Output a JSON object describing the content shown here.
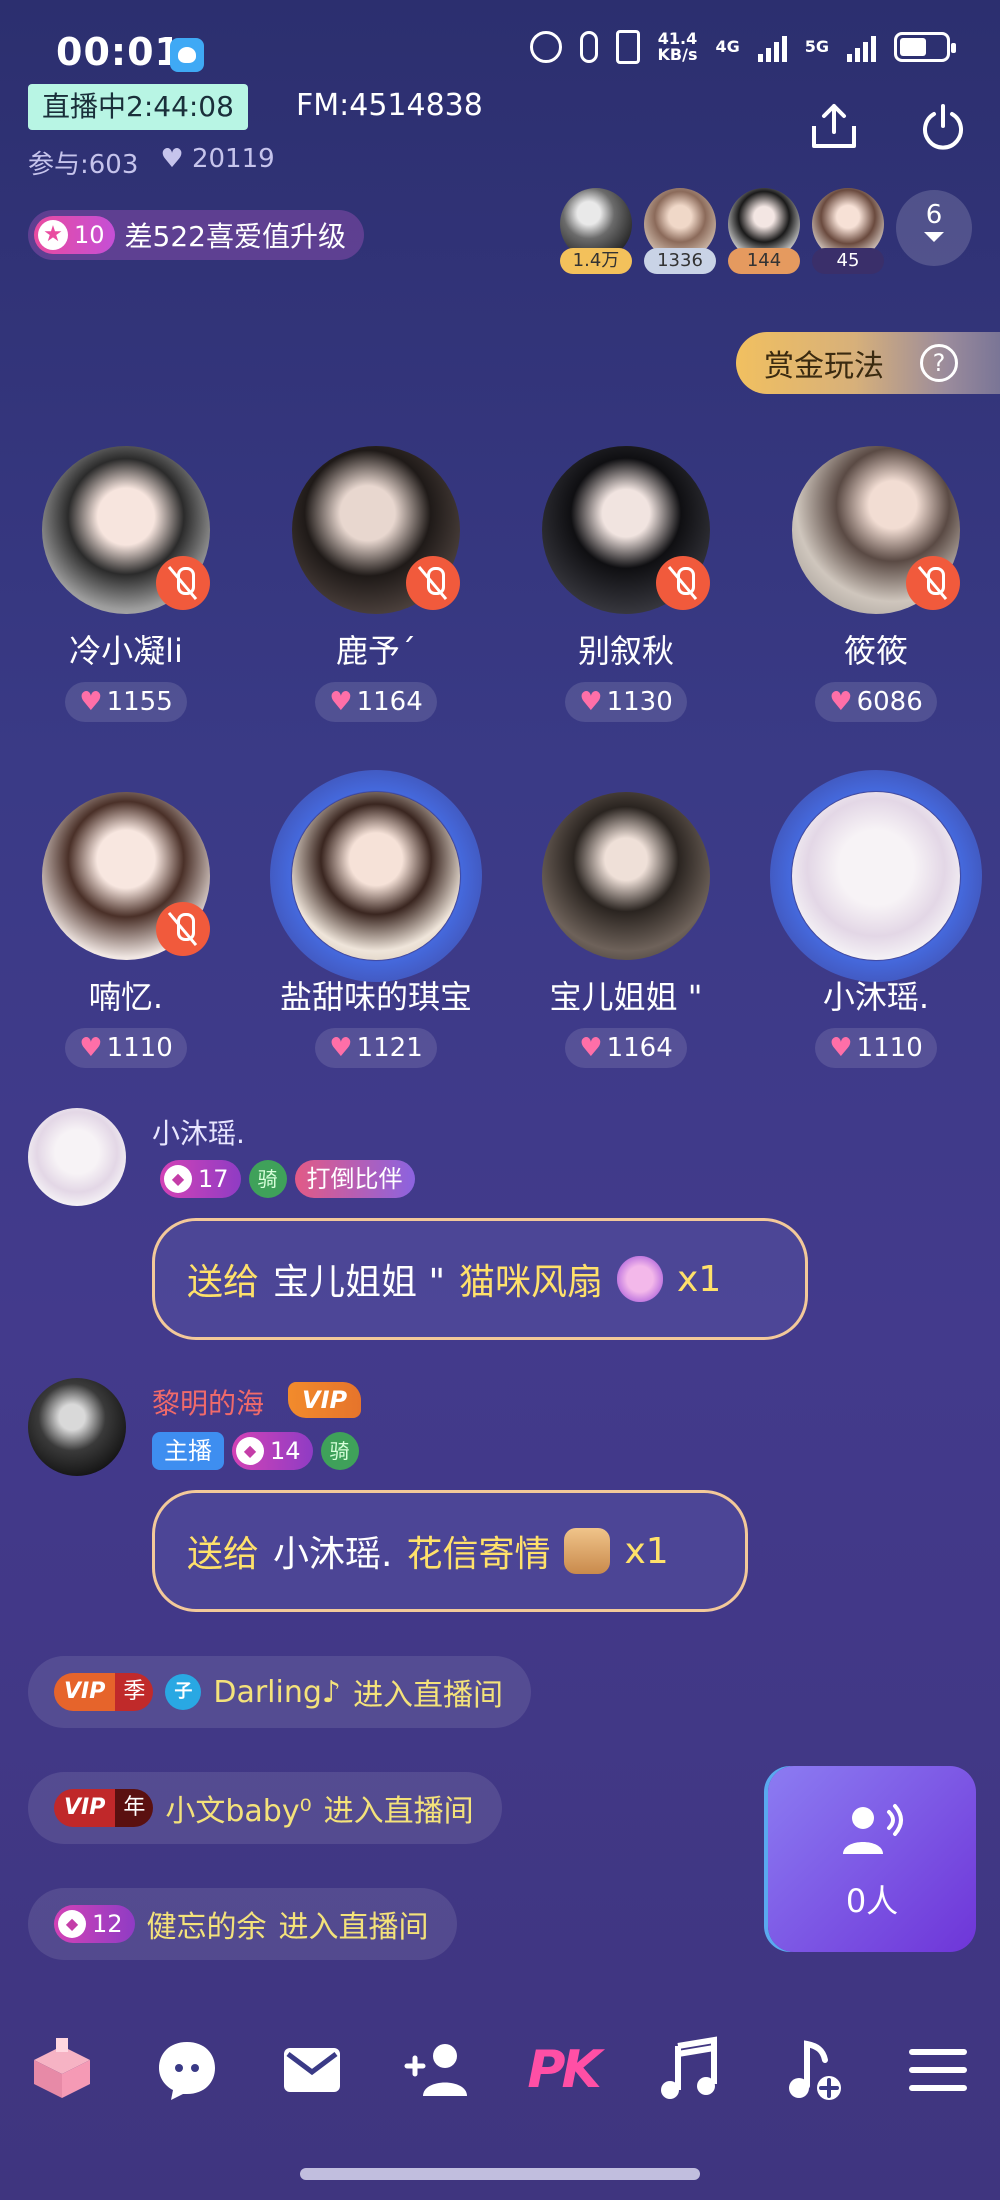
{
  "status_bar": {
    "time": "00:01",
    "speed_top": "41.4",
    "speed_unit": "KB/s",
    "net1": "4G",
    "net2": "5G"
  },
  "header": {
    "live_label": "直播中2:44:08",
    "fm_id": "FM:4514838",
    "participants": "参与:603",
    "likes": "20119",
    "level": "10",
    "level_hint": "差522喜爱值升级"
  },
  "ranking": [
    {
      "score": "1.4万",
      "color": "#f3c15b"
    },
    {
      "score": "1336",
      "color": "#c9d3e6"
    },
    {
      "score": "144",
      "color": "#e59a5f"
    },
    {
      "score": "45",
      "color": "#3a2f6a"
    }
  ],
  "ranking_more": "6",
  "bounty_label": "赏金玩法",
  "seats": [
    {
      "name": "冷小凝li",
      "score": "1155",
      "muted": true
    },
    {
      "name": "鹿予´",
      "score": "1164",
      "muted": true
    },
    {
      "name": "别叙秋",
      "score": "1130",
      "muted": true
    },
    {
      "name": "筱筱",
      "score": "6086",
      "muted": true
    },
    {
      "name": "喃忆.",
      "score": "1110",
      "muted": true
    },
    {
      "name": "盐甜味的琪宝",
      "score": "1121",
      "muted": false
    },
    {
      "name": "宝儿姐姐 \"",
      "score": "1164",
      "muted": false
    },
    {
      "name": "小沐瑶.",
      "score": "1110",
      "muted": false
    }
  ],
  "chat": [
    {
      "name": "小沐瑶.",
      "level": "17",
      "ride": "骑",
      "title": "打倒比伴",
      "gift_label": "送给",
      "gift_target": "宝儿姐姐 \"",
      "gift_item": "猫咪风扇",
      "gift_count": "x1"
    },
    {
      "name": "黎明的海",
      "vip": "VIP",
      "host": "主播",
      "level": "14",
      "ride": "骑",
      "gift_label": "送给",
      "gift_target": "小沐瑶.",
      "gift_item": "花信寄情",
      "gift_count": "x1"
    }
  ],
  "entries": [
    {
      "vip": "VIP",
      "term": "季",
      "wing": "子",
      "user": "Darling♪",
      "action": "进入直播间"
    },
    {
      "vip": "VIP",
      "term": "年",
      "user": "小文baby⁰",
      "action": "进入直播间"
    },
    {
      "level": "12",
      "user": "健忘的余",
      "action": "进入直播间"
    }
  ],
  "mic_queue": {
    "label": "0人"
  },
  "toolbar": {
    "pk": "PK"
  },
  "colors": {
    "accent": "#6e35d8",
    "gift_text": "#ffe16a",
    "mute": "#f15a3c"
  }
}
